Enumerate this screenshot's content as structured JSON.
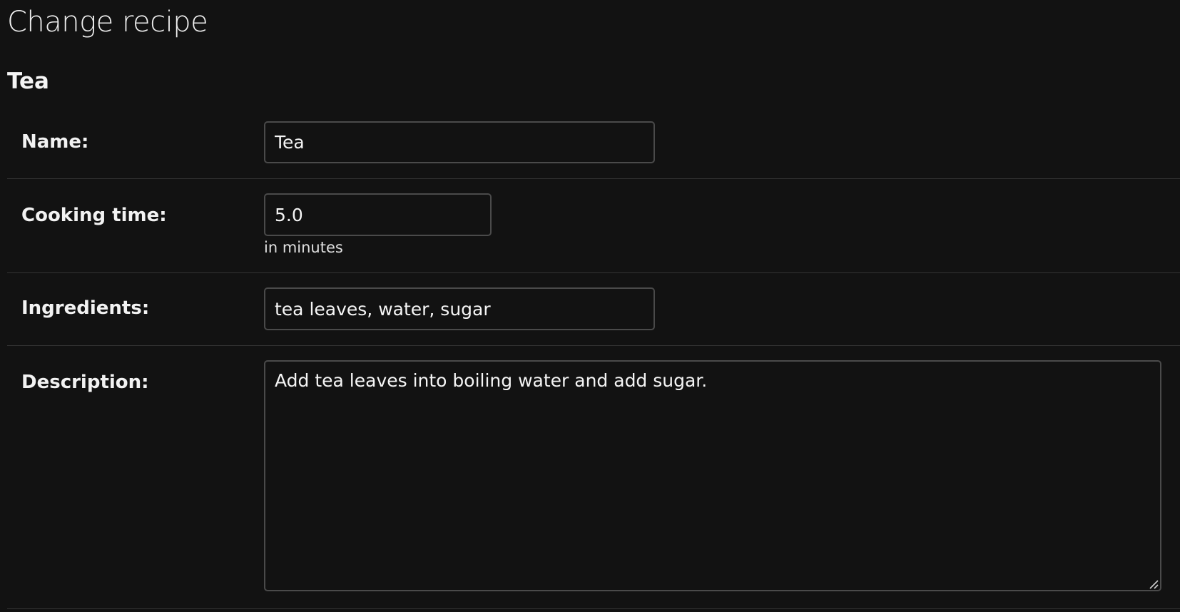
{
  "page": {
    "title": "Change recipe",
    "object_title": "Tea"
  },
  "form": {
    "name": {
      "label": "Name:",
      "value": "Tea"
    },
    "cooking_time": {
      "label": "Cooking time:",
      "value": "5.0",
      "help": "in minutes"
    },
    "ingredients": {
      "label": "Ingredients:",
      "value": "tea leaves, water, sugar"
    },
    "description": {
      "label": "Description:",
      "value": "Add tea leaves into boiling water and add sugar."
    }
  },
  "icons": {
    "resize": "resize-grip-icon"
  },
  "colors": {
    "background": "#121212",
    "text": "#f5f5f5",
    "input_border": "#4a4a4a",
    "divider": "#333333"
  }
}
